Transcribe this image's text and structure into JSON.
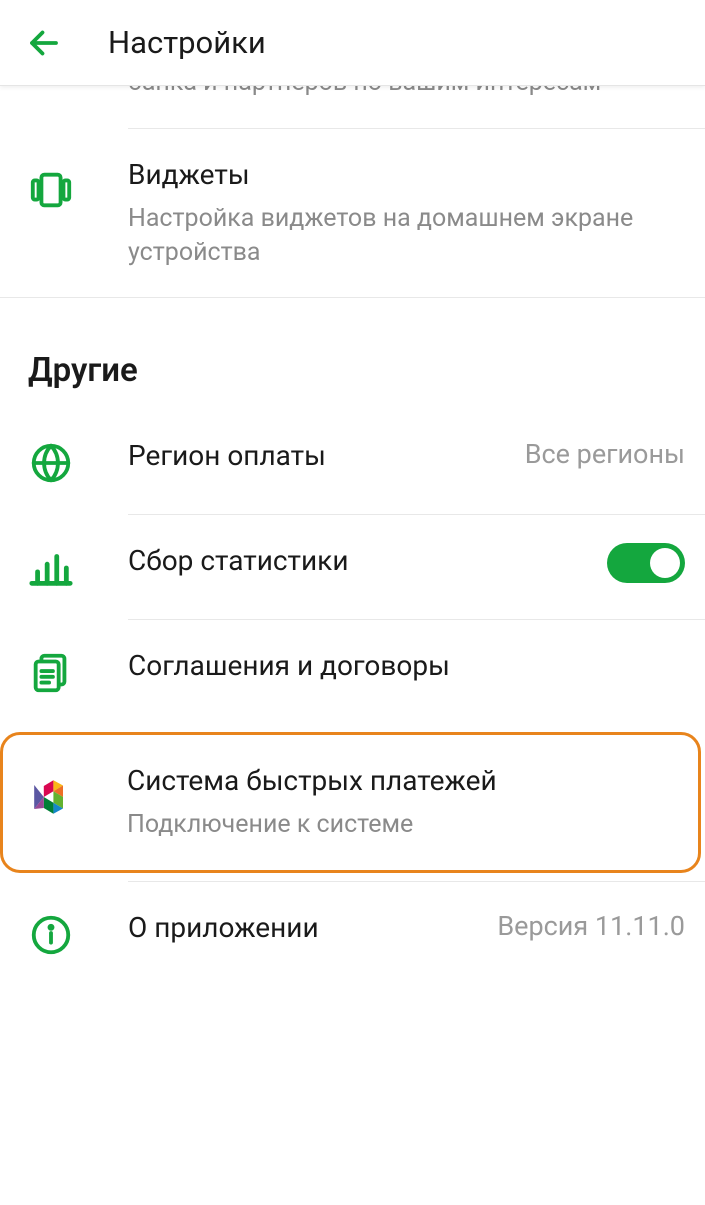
{
  "header": {
    "title": "Настройки"
  },
  "items": {
    "partial_top": {
      "sub": "банка и партнёров по вашим интересам"
    },
    "widgets": {
      "title": "Виджеты",
      "sub": "Настройка виджетов на домашнем экране устройства"
    }
  },
  "section_other": {
    "title": "Другие"
  },
  "region": {
    "title": "Регион оплаты",
    "value": "Все регионы"
  },
  "stats": {
    "title": "Сбор статистики",
    "toggle": true
  },
  "agreements": {
    "title": "Соглашения и договоры"
  },
  "sbp": {
    "title": "Система быстрых платежей",
    "sub": "Подключение к системе"
  },
  "about": {
    "title": "О приложении",
    "value": "Версия 11.11.0"
  }
}
